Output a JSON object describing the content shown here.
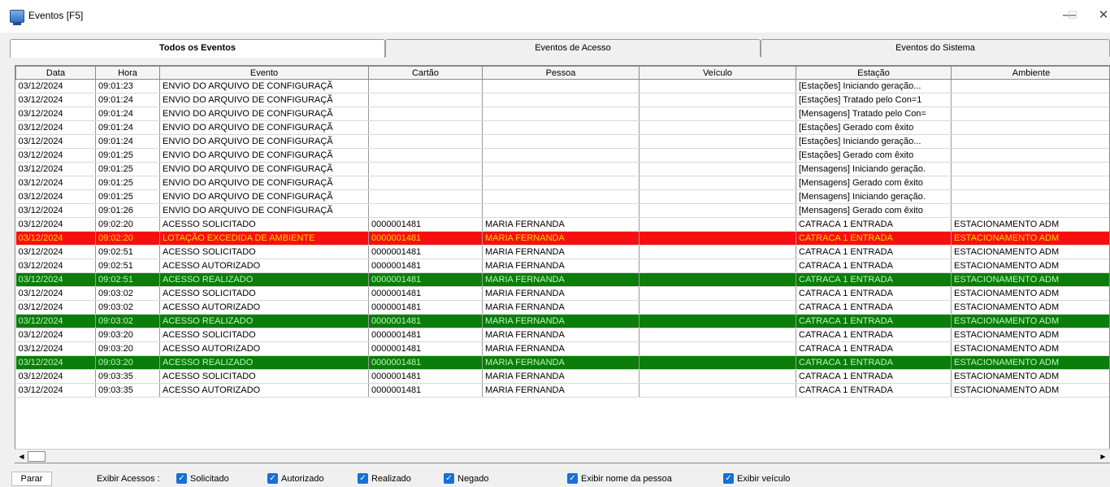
{
  "window": {
    "title": "Eventos [F5]",
    "minimize": "—",
    "maximize": "☐",
    "close": "✕"
  },
  "tabs": [
    {
      "label": "Todos os Eventos",
      "active": true
    },
    {
      "label": "Eventos de Acesso",
      "active": false
    },
    {
      "label": "Eventos do Sistema",
      "active": false
    }
  ],
  "table": {
    "columns": [
      "Data",
      "Hora",
      "Evento",
      "Cartão",
      "Pessoa",
      "Veículo",
      "Estação",
      "Ambiente"
    ],
    "rows": [
      {
        "style": "",
        "cells": [
          "03/12/2024",
          "09:01:23",
          "ENVIO DO ARQUIVO DE CONFIGURAÇÃ",
          "",
          "",
          "",
          "[Estações] Iniciando geração...",
          ""
        ]
      },
      {
        "style": "",
        "cells": [
          "03/12/2024",
          "09:01:24",
          "ENVIO DO ARQUIVO DE CONFIGURAÇÃ",
          "",
          "",
          "",
          "[Estações] Tratado pelo Con=1",
          ""
        ]
      },
      {
        "style": "",
        "cells": [
          "03/12/2024",
          "09:01:24",
          "ENVIO DO ARQUIVO DE CONFIGURAÇÃ",
          "",
          "",
          "",
          "[Mensagens] Tratado pelo Con=",
          ""
        ]
      },
      {
        "style": "",
        "cells": [
          "03/12/2024",
          "09:01:24",
          "ENVIO DO ARQUIVO DE CONFIGURAÇÃ",
          "",
          "",
          "",
          "[Estações] Gerado com êxito",
          ""
        ]
      },
      {
        "style": "",
        "cells": [
          "03/12/2024",
          "09:01:24",
          "ENVIO DO ARQUIVO DE CONFIGURAÇÃ",
          "",
          "",
          "",
          "[Estações] Iniciando geração...",
          ""
        ]
      },
      {
        "style": "",
        "cells": [
          "03/12/2024",
          "09:01:25",
          "ENVIO DO ARQUIVO DE CONFIGURAÇÃ",
          "",
          "",
          "",
          "[Estações] Gerado com êxito",
          ""
        ]
      },
      {
        "style": "",
        "cells": [
          "03/12/2024",
          "09:01:25",
          "ENVIO DO ARQUIVO DE CONFIGURAÇÃ",
          "",
          "",
          "",
          "[Mensagens] Iniciando geração.",
          ""
        ]
      },
      {
        "style": "",
        "cells": [
          "03/12/2024",
          "09:01:25",
          "ENVIO DO ARQUIVO DE CONFIGURAÇÃ",
          "",
          "",
          "",
          "[Mensagens] Gerado com êxito",
          ""
        ]
      },
      {
        "style": "",
        "cells": [
          "03/12/2024",
          "09:01:25",
          "ENVIO DO ARQUIVO DE CONFIGURAÇÃ",
          "",
          "",
          "",
          "[Mensagens] Iniciando geração.",
          ""
        ]
      },
      {
        "style": "",
        "cells": [
          "03/12/2024",
          "09:01:26",
          "ENVIO DO ARQUIVO DE CONFIGURAÇÃ",
          "",
          "",
          "",
          "[Mensagens] Gerado com êxito",
          ""
        ]
      },
      {
        "style": "",
        "cells": [
          "03/12/2024",
          "09:02:20",
          "ACESSO SOLICITADO",
          "0000001481",
          "MARIA FERNANDA",
          "",
          "CATRACA 1 ENTRADA",
          "ESTACIONAMENTO ADM"
        ]
      },
      {
        "style": "red",
        "cells": [
          "03/12/2024",
          "09:02:20",
          "LOTAÇÃO EXCEDIDA DE AMBIENTE",
          "0000001481",
          "MARIA FERNANDA",
          "",
          "CATRACA 1 ENTRADA",
          "ESTACIONAMENTO ADM"
        ]
      },
      {
        "style": "",
        "cells": [
          "03/12/2024",
          "09:02:51",
          "ACESSO SOLICITADO",
          "0000001481",
          "MARIA FERNANDA",
          "",
          "CATRACA 1 ENTRADA",
          "ESTACIONAMENTO ADM"
        ]
      },
      {
        "style": "",
        "cells": [
          "03/12/2024",
          "09:02:51",
          "ACESSO AUTORIZADO",
          "0000001481",
          "MARIA FERNANDA",
          "",
          "CATRACA 1 ENTRADA",
          "ESTACIONAMENTO ADM"
        ]
      },
      {
        "style": "green",
        "cells": [
          "03/12/2024",
          "09:02:51",
          "ACESSO REALIZADO",
          "0000001481",
          "MARIA FERNANDA",
          "",
          "CATRACA 1 ENTRADA",
          "ESTACIONAMENTO ADM"
        ]
      },
      {
        "style": "",
        "cells": [
          "03/12/2024",
          "09:03:02",
          "ACESSO SOLICITADO",
          "0000001481",
          "MARIA FERNANDA",
          "",
          "CATRACA 1 ENTRADA",
          "ESTACIONAMENTO ADM"
        ]
      },
      {
        "style": "",
        "cells": [
          "03/12/2024",
          "09:03:02",
          "ACESSO AUTORIZADO",
          "0000001481",
          "MARIA FERNANDA",
          "",
          "CATRACA 1 ENTRADA",
          "ESTACIONAMENTO ADM"
        ]
      },
      {
        "style": "green",
        "cells": [
          "03/12/2024",
          "09:03:02",
          "ACESSO REALIZADO",
          "0000001481",
          "MARIA FERNANDA",
          "",
          "CATRACA 1 ENTRADA",
          "ESTACIONAMENTO ADM"
        ]
      },
      {
        "style": "",
        "cells": [
          "03/12/2024",
          "09:03:20",
          "ACESSO SOLICITADO",
          "0000001481",
          "MARIA FERNANDA",
          "",
          "CATRACA 1 ENTRADA",
          "ESTACIONAMENTO ADM"
        ]
      },
      {
        "style": "",
        "cells": [
          "03/12/2024",
          "09:03:20",
          "ACESSO AUTORIZADO",
          "0000001481",
          "MARIA FERNANDA",
          "",
          "CATRACA 1 ENTRADA",
          "ESTACIONAMENTO ADM"
        ]
      },
      {
        "style": "green",
        "cells": [
          "03/12/2024",
          "09:03:20",
          "ACESSO REALIZADO",
          "0000001481",
          "MARIA FERNANDA",
          "",
          "CATRACA 1 ENTRADA",
          "ESTACIONAMENTO ADM"
        ]
      },
      {
        "style": "",
        "cells": [
          "03/12/2024",
          "09:03:35",
          "ACESSO SOLICITADO",
          "0000001481",
          "MARIA FERNANDA",
          "",
          "CATRACA 1 ENTRADA",
          "ESTACIONAMENTO ADM"
        ]
      },
      {
        "style": "",
        "cells": [
          "03/12/2024",
          "09:03:35",
          "ACESSO AUTORIZADO",
          "0000001481",
          "MARIA FERNANDA",
          "",
          "CATRACA 1 ENTRADA",
          "ESTACIONAMENTO ADM"
        ]
      }
    ]
  },
  "colors": {
    "row_red_bg": "#f70f0f",
    "row_red_text": "#ffd800",
    "row_green_bg": "#0a7d0a",
    "row_green_text": "#bdf4bd",
    "checkbox_accent": "#1a6fd4"
  },
  "bottom": {
    "stop_label": "Parar",
    "show_label": "Exibir Acessos :",
    "checkboxes": [
      {
        "label": "Solicitado",
        "checked": true
      },
      {
        "label": "Autorizado",
        "checked": true
      },
      {
        "label": "Realizado",
        "checked": true
      },
      {
        "label": "Negado",
        "checked": true
      },
      {
        "label": "Exibir nome da pessoa",
        "checked": true
      },
      {
        "label": "Exibir veículo",
        "checked": true
      }
    ]
  },
  "scrollbar": {
    "left_arrow": "◀",
    "right_arrow": "▶"
  }
}
